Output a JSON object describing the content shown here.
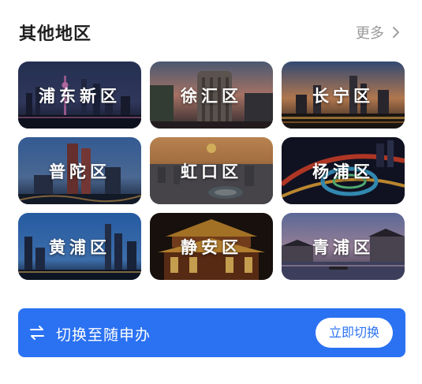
{
  "section": {
    "title": "其他地区",
    "more_label": "更多",
    "more_icon": "chevron-right-icon"
  },
  "districts": [
    {
      "label": "浦东新区",
      "scene": "night-skyline"
    },
    {
      "label": "徐汇区",
      "scene": "sunset-historic-building"
    },
    {
      "label": "长宁区",
      "scene": "dusk-city-lights"
    },
    {
      "label": "普陀区",
      "scene": "blue-hour-towers"
    },
    {
      "label": "虹口区",
      "scene": "sunset-stadium"
    },
    {
      "label": "杨浦区",
      "scene": "night-interchange"
    },
    {
      "label": "黄浦区",
      "scene": "blue-skyline"
    },
    {
      "label": "静安区",
      "scene": "lit-temple-night"
    },
    {
      "label": "青浦区",
      "scene": "water-town-dusk"
    }
  ],
  "switch_bar": {
    "icon": "swap-arrows-icon",
    "text": "切换至随申办",
    "button_label": "立即切换",
    "background_color": "#2b72f2"
  }
}
